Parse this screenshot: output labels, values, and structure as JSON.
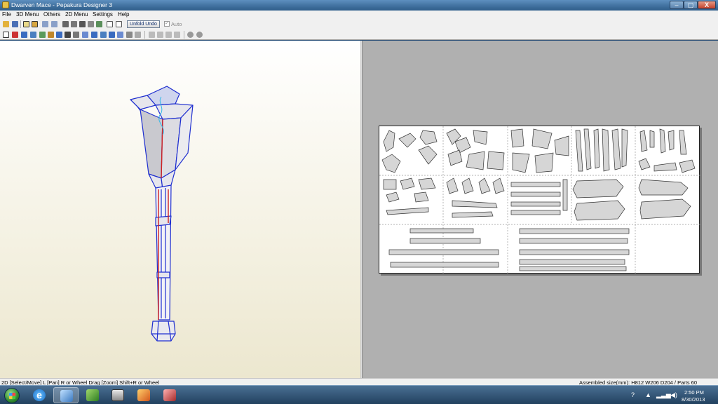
{
  "window": {
    "title": "Dwarven Mace - Pepakura Designer 3",
    "min_label": "–",
    "max_label": "▢",
    "close_label": "X"
  },
  "menu": {
    "items": [
      "File",
      "3D Menu",
      "Others",
      "2D Menu",
      "Settings",
      "Help"
    ]
  },
  "toolbar": {
    "unfold_undo_label": "Unfold Undo",
    "auto_label": "Auto",
    "auto_checked": true
  },
  "status": {
    "hint": "2D [Select/Move] L [Pan] R or Wheel Drag [Zoom] Shift+R or Wheel",
    "assembled": "Assembled size(mm): H812 W206 D204 / Parts 60"
  },
  "taskbar": {
    "time": "2:50 PM",
    "date": "8/30/2013",
    "apps": [
      "start-orb",
      "internet-explorer",
      "pepakura",
      "green-leaf-app",
      "computer-app",
      "orange-app",
      "3d-app"
    ]
  },
  "colors": {
    "titlebar": "#3f6f9d",
    "view3d_bg": "#f4f1e2",
    "view2d_bg": "#b0b0b0",
    "model_edge": "#1f2fd0",
    "model_seam": "#d02020",
    "part_fill": "#d6d6d6"
  }
}
